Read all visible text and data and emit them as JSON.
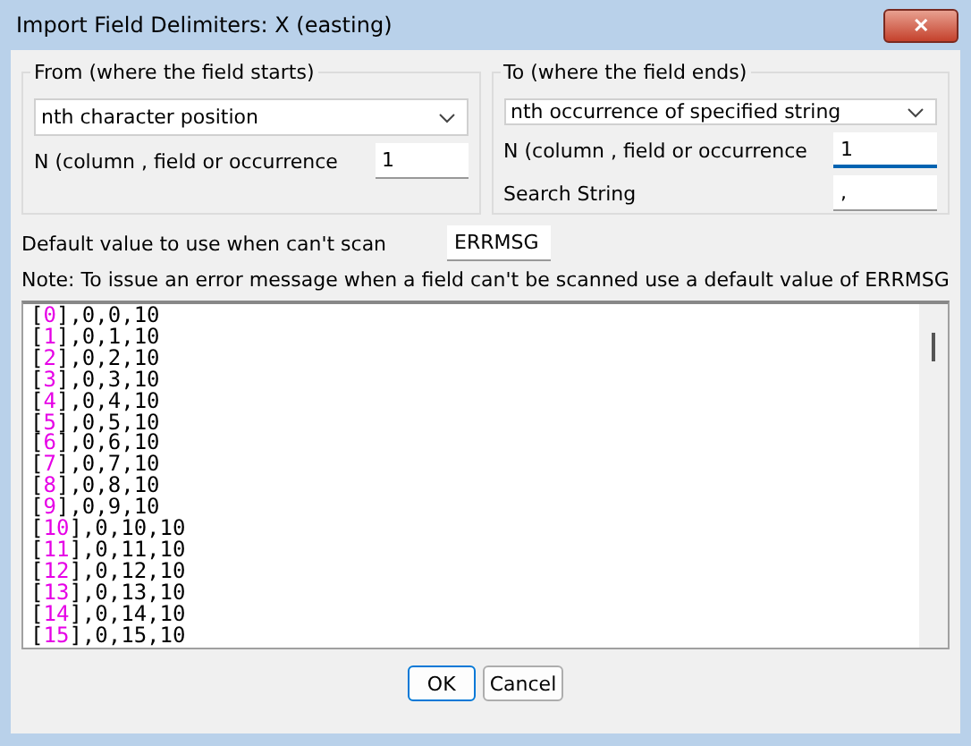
{
  "window": {
    "title": "Import Field Delimiters: X (easting)",
    "close": "✕"
  },
  "from": {
    "title": "From (where the field starts)",
    "dropdown": "nth character position",
    "n_label": "N (column , field or occurrence",
    "n_value": "1"
  },
  "to": {
    "title": "To (where the field ends)",
    "dropdown": "nth occurrence of specified string",
    "n_label": "N (column , field or occurrence",
    "n_value": "1",
    "search_label": "Search String",
    "search_value": ","
  },
  "default": {
    "label": "Default value to use when can't scan",
    "value": "ERRMSG"
  },
  "note": "Note: To issue an error message when a field can't be scanned use a default value of ERRMSG",
  "listing": {
    "bracket_open": "[",
    "bracket_close": "]",
    "lines": [
      {
        "index": "0",
        "rest": ",0,0,10"
      },
      {
        "index": "1",
        "rest": ",0,1,10"
      },
      {
        "index": "2",
        "rest": ",0,2,10"
      },
      {
        "index": "3",
        "rest": ",0,3,10"
      },
      {
        "index": "4",
        "rest": ",0,4,10"
      },
      {
        "index": "5",
        "rest": ",0,5,10"
      },
      {
        "index": "6",
        "rest": ",0,6,10"
      },
      {
        "index": "7",
        "rest": ",0,7,10"
      },
      {
        "index": "8",
        "rest": ",0,8,10"
      },
      {
        "index": "9",
        "rest": ",0,9,10"
      },
      {
        "index": "10",
        "rest": ",0,10,10"
      },
      {
        "index": "11",
        "rest": ",0,11,10"
      },
      {
        "index": "12",
        "rest": ",0,12,10"
      },
      {
        "index": "13",
        "rest": ",0,13,10"
      },
      {
        "index": "14",
        "rest": ",0,14,10"
      },
      {
        "index": "15",
        "rest": ",0,15,10"
      }
    ]
  },
  "buttons": [
    {
      "label": "OK",
      "selected": true
    },
    {
      "label": "Cancel",
      "selected": false
    }
  ]
}
